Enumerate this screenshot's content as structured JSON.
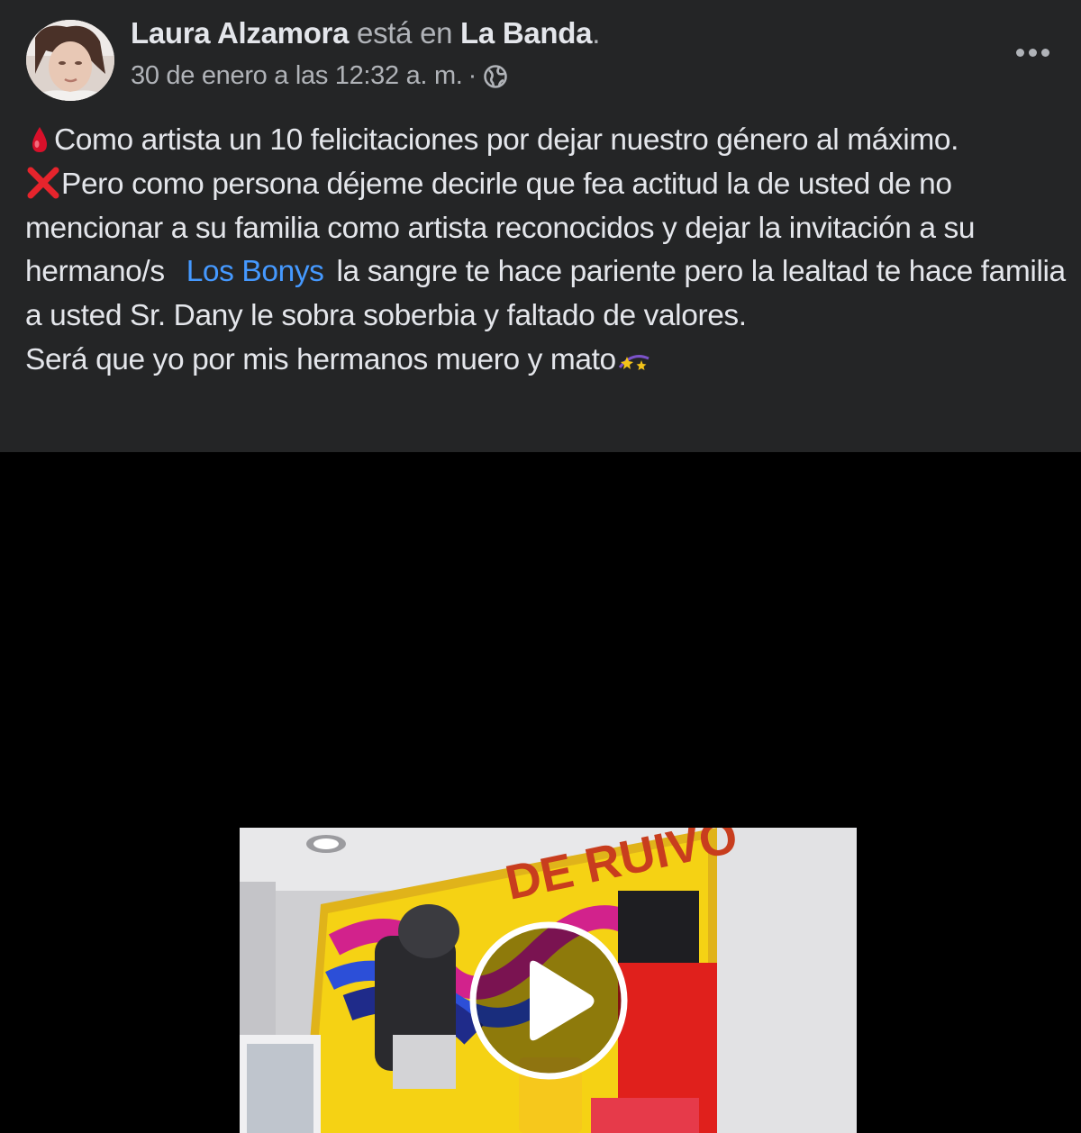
{
  "post": {
    "author": "Laura Alzamora",
    "status_verb": " está en ",
    "place": "La Banda",
    "place_suffix": ".",
    "timestamp": "30 de enero a las 12:32 a. m.",
    "separator": "·",
    "privacy_icon": "globe-icon",
    "more_icon": "more-horizontal-icon",
    "text": {
      "line1": "Como artista un 10 felicitaciones por dejar nuestro género al máximo.",
      "line2_a": "Pero como persona déjeme decirle que fea actitud la de usted de no mencionar a su familia como artista reconocidos y dejar la invitación a su hermano/s",
      "mention": "Los Bonys",
      "line2_b": "la sangre te hace pariente pero la lealtad te hace familia a usted Sr. Dany le sobra soberbia y faltado de valores.",
      "line3": "Será que yo por mis hermanos muero y mato"
    },
    "emojis": [
      "drop-of-blood-icon",
      "cross-mark-icon",
      "dizzy-stars-icon"
    ]
  },
  "video": {
    "play_icon": "play-icon",
    "thumbnail_text": "DE RUIVO"
  },
  "colors": {
    "card_bg": "#242526",
    "text_primary": "#e4e6eb",
    "text_secondary": "#b0b3b8",
    "link": "#4599ff",
    "page_bg": "#000000"
  }
}
